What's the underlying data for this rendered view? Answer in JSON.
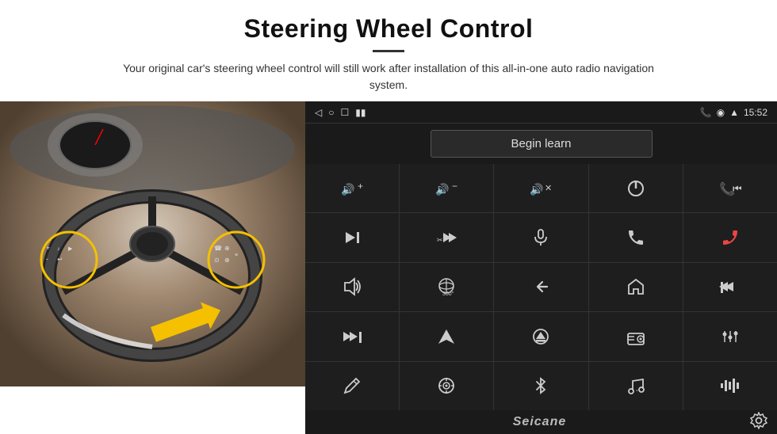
{
  "header": {
    "title": "Steering Wheel Control",
    "subtitle": "Your original car's steering wheel control will still work after installation of this all-in-one auto radio navigation system."
  },
  "status_bar": {
    "time": "15:52",
    "icons_left": [
      "◁",
      "⬜",
      "⬜"
    ],
    "icons_right": [
      "📞",
      "📍",
      "📶",
      "🔋"
    ]
  },
  "begin_learn": {
    "label": "Begin learn"
  },
  "controls": [
    {
      "icon": "🔊+",
      "label": "vol_up"
    },
    {
      "icon": "🔊-",
      "label": "vol_down"
    },
    {
      "icon": "🔇",
      "label": "mute"
    },
    {
      "icon": "⏻",
      "label": "power"
    },
    {
      "icon": "⏮",
      "label": "prev_track"
    },
    {
      "icon": "⏭",
      "label": "next"
    },
    {
      "icon": "✂⏭",
      "label": "ff"
    },
    {
      "icon": "🎙",
      "label": "mic"
    },
    {
      "icon": "📞",
      "label": "call"
    },
    {
      "icon": "↩",
      "label": "hang_up"
    },
    {
      "icon": "📢",
      "label": "horn"
    },
    {
      "icon": "⊙",
      "label": "360"
    },
    {
      "icon": "↩",
      "label": "back"
    },
    {
      "icon": "🏠",
      "label": "home"
    },
    {
      "icon": "⏮⏮",
      "label": "rewind"
    },
    {
      "icon": "⏭⏭",
      "label": "ff2"
    },
    {
      "icon": "▲",
      "label": "nav"
    },
    {
      "icon": "⏏",
      "label": "eject"
    },
    {
      "icon": "📻",
      "label": "radio"
    },
    {
      "icon": "⚙",
      "label": "settings2"
    },
    {
      "icon": "✏",
      "label": "pen"
    },
    {
      "icon": "⊛",
      "label": "circle2"
    },
    {
      "icon": "✱",
      "label": "bluetooth"
    },
    {
      "icon": "🎵",
      "label": "music"
    },
    {
      "icon": "📊",
      "label": "equalizer"
    }
  ],
  "bottom": {
    "logo": "Seicane"
  }
}
